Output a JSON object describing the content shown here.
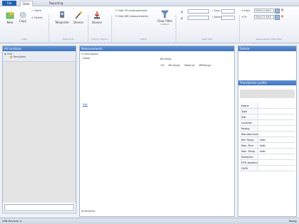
{
  "titlebar": {
    "file_label": "File",
    "tabs": [
      {
        "label": "Data"
      },
      {
        "label": "Reporting"
      }
    ]
  },
  "ribbon": {
    "new_label": "New",
    "delete_label": "Delete",
    "copy_label": "Copy",
    "paste_label": "Paste",
    "new2_label": "Teleporter",
    "device_label": "Device",
    "device2_label": "Device",
    "filter_hide_tr": "Hide TR measurements",
    "filter_hide_wr": "Hide WR measurements",
    "clear_filter_label": "Clear filter",
    "clear_filter_sub": "method",
    "type_label": "Type",
    "select_label": "Select",
    "from_label": "From",
    "to_label": "To",
    "from_value": "Select a date",
    "to_value": "Select a date",
    "captions": [
      "Data",
      "Data Tools",
      "Import / Export",
      "Filters",
      "Data filter",
      "Measurement date filter"
    ]
  },
  "left_panel": {
    "header": "All locations",
    "tree_root": "Tree",
    "tree_child": "Templates"
  },
  "center_panel": {
    "header": "Measurements",
    "description_label": "Description",
    "detail_label": "Detail",
    "windings_label": "Windings",
    "columns": [
      "HV",
      "Winding2",
      "Material",
      "WRRange"
    ],
    "link_label": "Edit",
    "remarks_label": "Remarks"
  },
  "right_panel": {
    "header": "Details",
    "section_header": "Transformer profile",
    "fields": [
      {
        "label": "Name",
        "value": ""
      },
      {
        "label": "Type",
        "value": ""
      },
      {
        "label": "S/N",
        "value": ""
      },
      {
        "label": "Location",
        "value": ""
      },
      {
        "label": "Rating",
        "value": ""
      },
      {
        "label": "Manufacturer",
        "value": ""
      },
      {
        "label": "Ref. Temp.",
        "value": "NaN"
      },
      {
        "label": "Max. Tem. Dev.",
        "value": "NaN"
      },
      {
        "label": "Max. Temp Dev.",
        "value": "NaN"
      },
      {
        "label": "Standard",
        "value": ""
      },
      {
        "label": "DTR position",
        "value": ""
      },
      {
        "label": "GUID",
        "value": ""
      }
    ]
  },
  "status": {
    "left_text": "USB Devices: 0",
    "right_text": "Ready"
  },
  "colors": {
    "header_blue": "#4a7fc7",
    "file_blue": "#1f5fb3",
    "delete_red": "#cc2222"
  }
}
